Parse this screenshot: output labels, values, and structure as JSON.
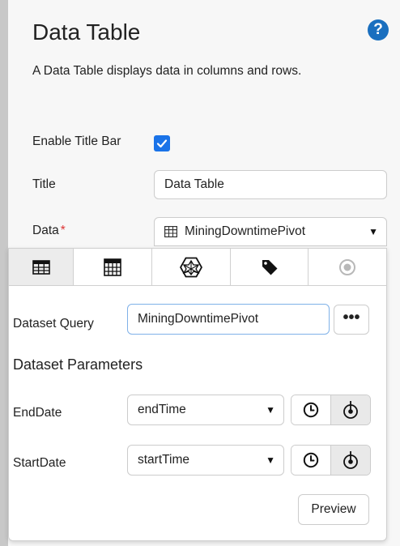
{
  "header": {
    "title": "Data Table",
    "help_icon": "?",
    "description": "A Data Table displays data in columns and rows."
  },
  "form": {
    "enable_title_bar_label": "Enable Title Bar",
    "enable_title_bar_checked": true,
    "title_label": "Title",
    "title_value": "Data Table",
    "data_label": "Data",
    "data_required_mark": "*",
    "data_value": "MiningDowntimePivot",
    "data_caret": "▼"
  },
  "popup": {
    "tabs": [
      {
        "icon": "table-icon",
        "active": true
      },
      {
        "icon": "calculator-grid-icon",
        "active": false
      },
      {
        "icon": "hexagon-pattern-icon",
        "active": false
      },
      {
        "icon": "tag-icon",
        "active": false
      },
      {
        "icon": "target-icon",
        "active": false
      }
    ],
    "dataset_query_label": "Dataset Query",
    "dataset_query_value": "MiningDowntimePivot",
    "more_button": "•••",
    "parameters_heading": "Dataset Parameters",
    "params": [
      {
        "label": "EndDate",
        "value": "endTime",
        "caret": "▼"
      },
      {
        "label": "StartDate",
        "value": "startTime",
        "caret": "▼"
      }
    ],
    "preview_button": "Preview"
  },
  "colors": {
    "accent": "#1a73e8",
    "help": "#1a6fbf",
    "required": "#dd3333",
    "focus_border": "#7fb1e8"
  }
}
